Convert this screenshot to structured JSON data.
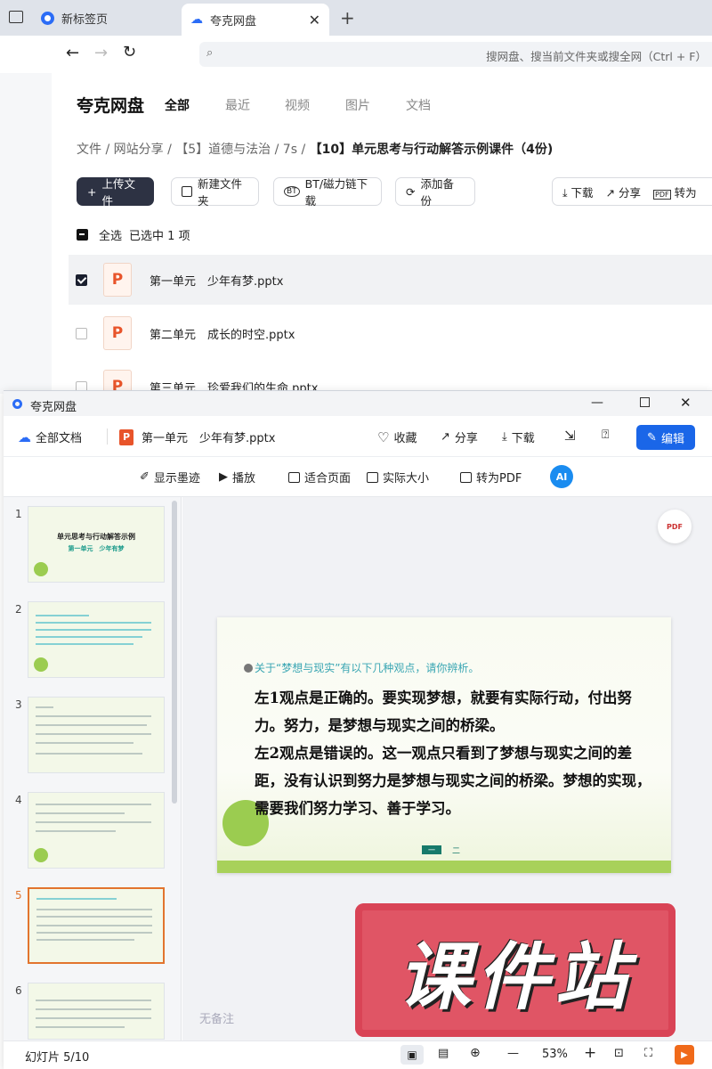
{
  "browser": {
    "tab1": "新标签页",
    "tab2": "夸克网盘",
    "tab_plus": "+",
    "address_placeholder": "搜网盘、搜当前文件夹或搜全网（Ctrl + F）"
  },
  "app": {
    "logo": "夸克网盘",
    "nav": [
      "全部",
      "最近",
      "视频",
      "图片",
      "文档"
    ],
    "breadcrumb": {
      "c1": "文件",
      "c2": "网站分享",
      "c3": "【5】道德与法治",
      "c4": "7s",
      "c5": "【10】单元思考与行动解答示例课件（4份)",
      "sep": "/"
    },
    "actions": {
      "upload": "上传文件",
      "new_folder": "新建文件夹",
      "bt": "BT/磁力链下载",
      "backup": "添加备份",
      "download": "下载",
      "share": "分享",
      "to_pdf": "转为"
    },
    "selection": {
      "select_all": "全选",
      "selected": "已选中",
      "count": "1",
      "unit": "项"
    },
    "files": [
      {
        "name": "第一单元　少年有梦.pptx",
        "checked": true
      },
      {
        "name": "第二单元　成长的时空.pptx",
        "checked": false
      },
      {
        "name": "第三单元　珍爱我们的生命.pptx",
        "checked": false
      }
    ]
  },
  "viewer": {
    "window_title": "夸克网盘",
    "all_docs": "全部文档",
    "file_name": "第一单元　少年有梦.pptx",
    "collect": "收藏",
    "share": "分享",
    "download": "下载",
    "edit": "编辑",
    "toolbar": {
      "ink": "显示墨迹",
      "play": "播放",
      "fit": "适合页面",
      "actual": "实际大小",
      "to_pdf": "转为PDF",
      "ai": "AI"
    },
    "thumbs": [
      {
        "num": "1",
        "title": "单元思考与行动解答示例",
        "subtitle": "第一单元　少年有梦"
      },
      {
        "num": "2"
      },
      {
        "num": "3"
      },
      {
        "num": "4"
      },
      {
        "num": "5"
      },
      {
        "num": "6"
      }
    ],
    "slide": {
      "intro": "关于“梦想与现实”有以下几种观点，请你辨析。",
      "line1": "左1观点是正确的。要实现梦想，就要有实际行动，付出努力。努力，是梦想与现实之间的桥梁。",
      "line2": "左2观点是错误的。这一观点只看到了梦想与现实之间的差距，没有认识到努力是梦想与现实之间的桥梁。梦想的实现，需要我们努力学习、善于学习。",
      "nav1": "一",
      "nav2": "二",
      "pdf_badge": "PDF"
    },
    "no_notes": "无备注",
    "status": {
      "slide_label": "幻灯片 5/10",
      "zoom": "53%",
      "minus": "—",
      "plus": "+"
    },
    "stamp": "课件站"
  }
}
